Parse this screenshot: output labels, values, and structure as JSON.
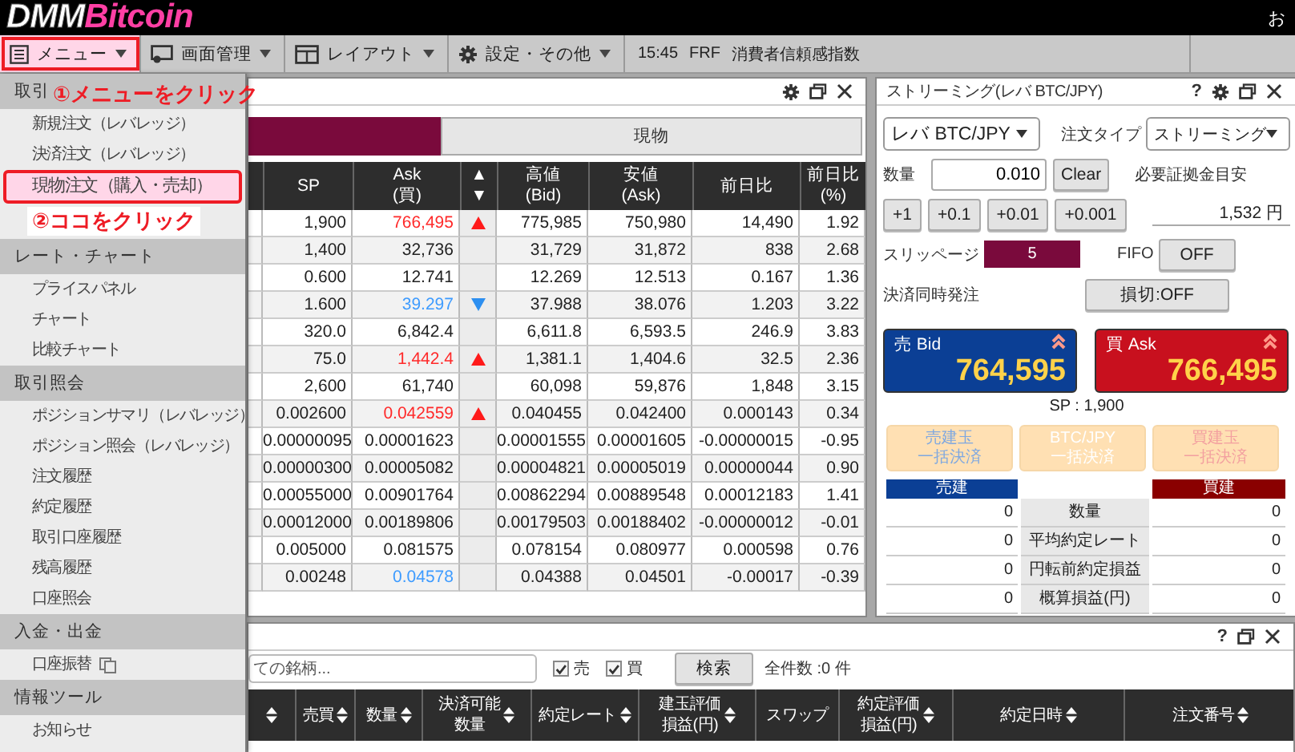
{
  "logo": {
    "brand": "DMM",
    "product": "Bitcoin"
  },
  "greeting": "お",
  "toolbar": {
    "menus": [
      {
        "label": "メニュー",
        "kind": "list",
        "highlighted": true
      },
      {
        "label": "画面管理",
        "kind": "screen",
        "highlighted": false
      },
      {
        "label": "レイアウト",
        "kind": "layout",
        "highlighted": false
      },
      {
        "label": "設定・その他",
        "kind": "gear",
        "highlighted": false
      }
    ],
    "news": {
      "time": "15:45",
      "currency": "FRF",
      "headline": "消費者信頼感指数"
    }
  },
  "menu": {
    "sections": [
      {
        "title": "取引",
        "header_note": "①メニューをクリック",
        "note": "②ココをクリック",
        "items": [
          {
            "label": "新規注文（レバレッジ）",
            "selected": false
          },
          {
            "label": "決済注文（レバレッジ）",
            "selected": false
          },
          {
            "label": "現物注文（購入・売却）",
            "selected": true
          }
        ]
      },
      {
        "title": "レート・チャート",
        "items": [
          {
            "label": "プライスパネル",
            "selected": false
          },
          {
            "label": "チャート",
            "selected": false
          },
          {
            "label": "比較チャート",
            "selected": false
          }
        ]
      },
      {
        "title": "取引照会",
        "items": [
          {
            "label": "ポジションサマリ（レバレッジ）",
            "selected": false
          },
          {
            "label": "ポジション照会（レバレッジ）",
            "selected": false
          },
          {
            "label": "注文履歴",
            "selected": false
          },
          {
            "label": "約定履歴",
            "selected": false
          },
          {
            "label": "取引口座履歴",
            "selected": false
          },
          {
            "label": "残高履歴",
            "selected": false
          },
          {
            "label": "口座照会",
            "selected": false
          }
        ]
      },
      {
        "title": "入金・出金",
        "items": [
          {
            "label": "口座振替",
            "selected": false,
            "external": true
          }
        ]
      },
      {
        "title": "情報ツール",
        "items": [
          {
            "label": "お知らせ",
            "selected": false
          }
        ]
      }
    ]
  },
  "price_board": {
    "tabs": [
      {
        "selected": true
      },
      {
        "label": "現物",
        "selected": false
      }
    ],
    "columns": [
      {
        "lines": [
          "SP"
        ]
      },
      {
        "lines": [
          "Ask",
          "(買)"
        ]
      },
      {
        "lines": [
          "▲",
          "▼"
        ]
      },
      {
        "lines": [
          "高値",
          "(Bid)"
        ]
      },
      {
        "lines": [
          "安値",
          "(Ask)"
        ]
      },
      {
        "lines": [
          "前日比"
        ]
      },
      {
        "lines": [
          "前日比",
          "(%)"
        ]
      }
    ],
    "rows": [
      {
        "sp": "1,900",
        "ask": "766,495",
        "ask_up": true,
        "ask_down": false,
        "arrow_up": true,
        "arrow_down": false,
        "high": "775,985",
        "low": "750,980",
        "change": "14,490",
        "change_pct": "1.92"
      },
      {
        "sp": "1,400",
        "ask": "32,736",
        "ask_up": false,
        "ask_down": false,
        "arrow_up": false,
        "arrow_down": false,
        "high": "31,729",
        "low": "31,872",
        "change": "838",
        "change_pct": "2.68"
      },
      {
        "sp": "0.600",
        "ask": "12.741",
        "ask_up": false,
        "ask_down": false,
        "arrow_up": false,
        "arrow_down": false,
        "high": "12.269",
        "low": "12.513",
        "change": "0.167",
        "change_pct": "1.36"
      },
      {
        "sp": "1.600",
        "ask": "39.297",
        "ask_up": false,
        "ask_down": true,
        "arrow_up": false,
        "arrow_down": true,
        "high": "37.988",
        "low": "38.076",
        "change": "1.203",
        "change_pct": "3.22"
      },
      {
        "sp": "320.0",
        "ask": "6,842.4",
        "ask_up": false,
        "ask_down": false,
        "arrow_up": false,
        "arrow_down": false,
        "high": "6,611.8",
        "low": "6,593.5",
        "change": "246.9",
        "change_pct": "3.83"
      },
      {
        "sp": "75.0",
        "ask": "1,442.4",
        "ask_up": true,
        "ask_down": false,
        "arrow_up": true,
        "arrow_down": false,
        "high": "1,381.1",
        "low": "1,404.6",
        "change": "32.5",
        "change_pct": "2.36"
      },
      {
        "sp": "2,600",
        "ask": "61,740",
        "ask_up": false,
        "ask_down": false,
        "arrow_up": false,
        "arrow_down": false,
        "high": "60,098",
        "low": "59,876",
        "change": "1,848",
        "change_pct": "3.15"
      },
      {
        "sp": "0.002600",
        "ask": "0.042559",
        "ask_up": true,
        "ask_down": false,
        "arrow_up": true,
        "arrow_down": false,
        "high": "0.040455",
        "low": "0.042400",
        "change": "0.000143",
        "change_pct": "0.34"
      },
      {
        "sp": "0.00000095",
        "ask": "0.00001623",
        "ask_up": false,
        "ask_down": false,
        "arrow_up": false,
        "arrow_down": false,
        "high": "0.00001555",
        "low": "0.00001605",
        "change": "-0.00000015",
        "change_pct": "-0.95"
      },
      {
        "sp": "0.00000300",
        "ask": "0.00005082",
        "ask_up": false,
        "ask_down": false,
        "arrow_up": false,
        "arrow_down": false,
        "high": "0.00004821",
        "low": "0.00005019",
        "change": "0.00000044",
        "change_pct": "0.90"
      },
      {
        "sp": "0.00055000",
        "ask": "0.00901764",
        "ask_up": false,
        "ask_down": false,
        "arrow_up": false,
        "arrow_down": false,
        "high": "0.00862294",
        "low": "0.00889548",
        "change": "0.00012183",
        "change_pct": "1.41"
      },
      {
        "sp": "0.00012000",
        "ask": "0.00189806",
        "ask_up": false,
        "ask_down": false,
        "arrow_up": false,
        "arrow_down": false,
        "high": "0.00179503",
        "low": "0.00188402",
        "change": "-0.00000012",
        "change_pct": "-0.01"
      },
      {
        "sp": "0.005000",
        "ask": "0.081575",
        "ask_up": false,
        "ask_down": false,
        "arrow_up": false,
        "arrow_down": false,
        "high": "0.078154",
        "low": "0.080977",
        "change": "0.000598",
        "change_pct": "0.76"
      },
      {
        "sp": "0.00248",
        "ask": "0.04578",
        "ask_up": false,
        "ask_down": true,
        "arrow_up": false,
        "arrow_down": false,
        "high": "0.04388",
        "low": "0.04501",
        "change": "-0.00017",
        "change_pct": "-0.39"
      }
    ]
  },
  "streaming": {
    "title": "ストリーミング(レバ BTC/JPY)",
    "help": "?",
    "pair": "レバ BTC/JPY",
    "order_type_label": "注文タイプ",
    "order_type": "ストリーミング",
    "quantity_label": "数量",
    "quantity": "0.010",
    "clear_button": "Clear",
    "margin_label": "必要証拠金目安",
    "margin_value": "1,532 円",
    "increments": [
      "+1",
      "+0.1",
      "+0.01",
      "+0.001"
    ],
    "slippage_label": "スリッページ",
    "slippage": "5",
    "fifo_label": "FIFO",
    "fifo_button": "OFF",
    "settle_label": "決済同時発注",
    "stop_button": "損切:OFF",
    "quotes": [
      {
        "kind": "sell",
        "label": "売 Bid",
        "price": "764,595"
      },
      {
        "kind": "buy",
        "label": "買 Ask",
        "price": "766,495"
      }
    ],
    "spread": "SP : 1,900",
    "bulk_buttons": [
      {
        "lines": [
          "売建玉",
          "一括決済"
        ],
        "disabled": true
      },
      {
        "lines": [
          "BTC/JPY",
          "一括決済"
        ],
        "disabled": true
      },
      {
        "lines": [
          "買建玉",
          "一括決済"
        ],
        "disabled": true
      }
    ],
    "positions": {
      "sell_header": "売建",
      "buy_header": "買建",
      "rows": [
        {
          "sell": "0",
          "label": "数量",
          "buy": "0"
        },
        {
          "sell": "0",
          "label": "平均約定レート",
          "buy": "0"
        },
        {
          "sell": "0",
          "label": "円転前約定損益",
          "buy": "0"
        },
        {
          "sell": "0",
          "label": "概算損益(円)",
          "buy": "0"
        }
      ]
    }
  },
  "orders": {
    "help": "?",
    "search_placeholder": "ての銘柄...",
    "filters": [
      {
        "label": "売",
        "checked": true
      },
      {
        "label": "買",
        "checked": true
      }
    ],
    "search_button": "検索",
    "count": "全件数 :0 件",
    "columns": [
      {
        "sortable": true
      },
      {
        "lines": [
          "売買"
        ],
        "sortable": true
      },
      {
        "lines": [
          "数量"
        ],
        "sortable": true
      },
      {
        "lines": [
          "決済可能",
          "数量"
        ],
        "sortable": true
      },
      {
        "lines": [
          "約定レート"
        ],
        "sortable": true
      },
      {
        "lines": [
          "建玉評価",
          "損益(円)"
        ],
        "sortable": true
      },
      {
        "lines": [
          "スワップ"
        ],
        "sortable": false
      },
      {
        "lines": [
          "約定評価",
          "損益(円)"
        ],
        "sortable": true
      },
      {
        "lines": [
          "約定日時"
        ],
        "sortable": true
      },
      {
        "lines": [
          "注文番号"
        ],
        "sortable": true
      }
    ]
  }
}
